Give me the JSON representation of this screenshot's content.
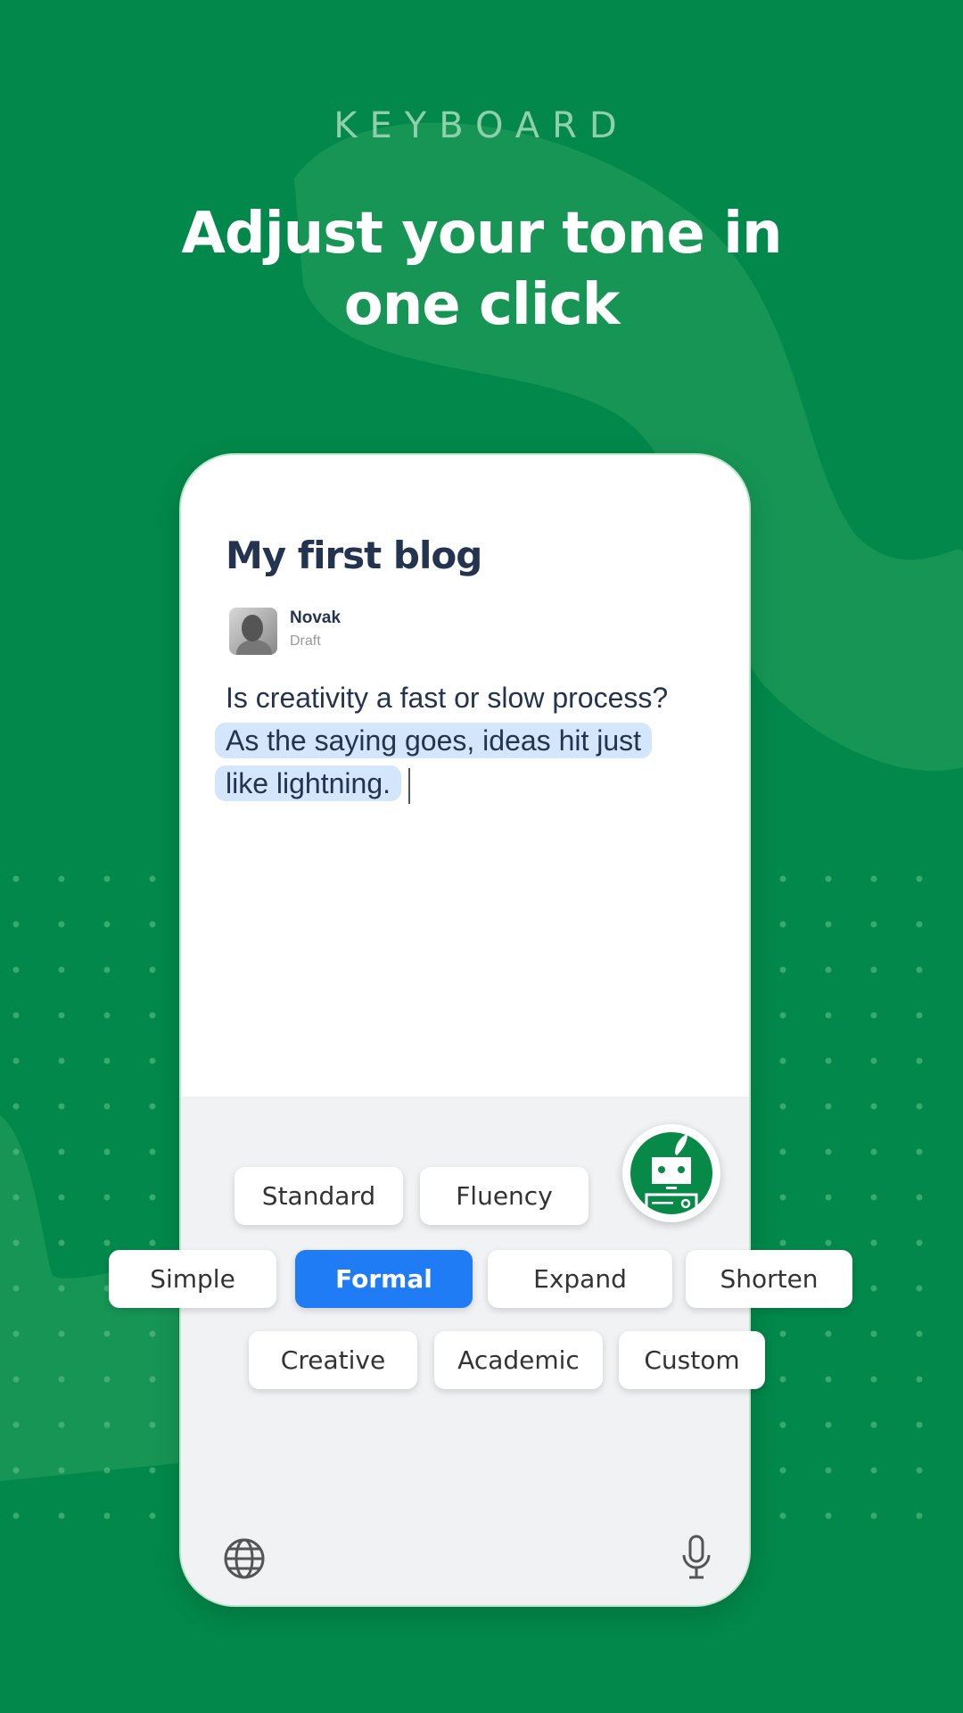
{
  "header": {
    "eyebrow": "KEYBOARD",
    "title_line1": "Adjust your tone in",
    "title_line2": "one click"
  },
  "colors": {
    "background": "#02884a",
    "accent": "#1f7cf5",
    "highlight": "#d3e6fb",
    "text": "#24334f"
  },
  "editor": {
    "title": "My first blog",
    "author": "Novak",
    "status": "Draft",
    "text_plain": "Is creativity a fast or slow process?",
    "text_highlighted_1": "As the saying goes, ideas hit just",
    "text_highlighted_2": "like lightning."
  },
  "keyboard": {
    "tones": [
      {
        "label": "Standard"
      },
      {
        "label": "Fluency"
      },
      {
        "label": "Simple"
      },
      {
        "label": "Formal",
        "selected": true
      },
      {
        "label": "Expand"
      },
      {
        "label": "Shorten"
      },
      {
        "label": "Creative"
      },
      {
        "label": "Academic"
      },
      {
        "label": "Custom"
      }
    ],
    "icons": {
      "assistant": "robot-quill-icon",
      "language": "globe-icon",
      "voice": "microphone-icon"
    }
  }
}
